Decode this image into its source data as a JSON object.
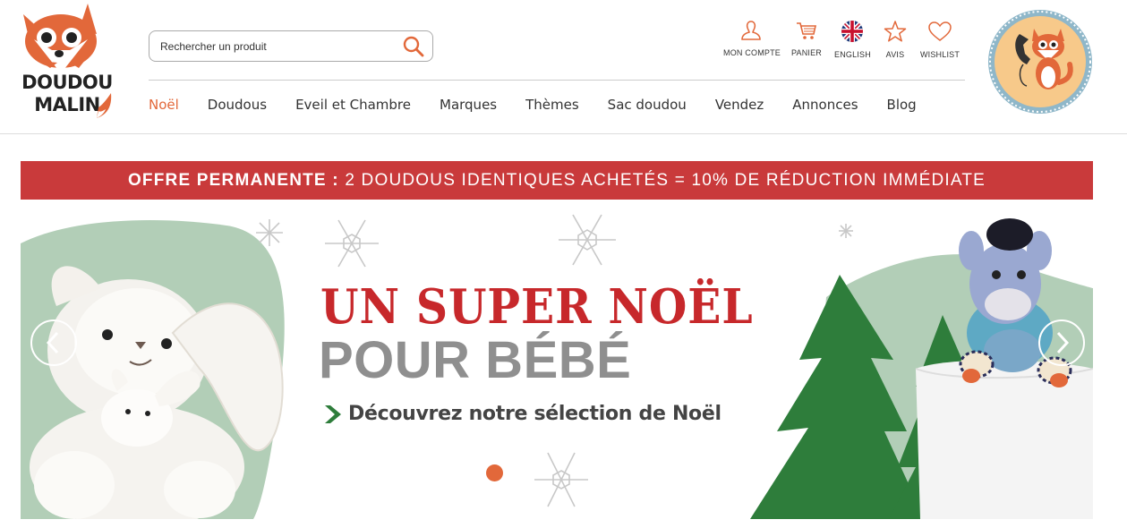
{
  "brand": {
    "logo_text_line1": "DOUDOU",
    "logo_text_line2": "MALIN",
    "accent": "#e2683a"
  },
  "search": {
    "placeholder": "Rechercher un produit",
    "icon": "search-icon"
  },
  "top_icons": [
    {
      "label": "MON COMPTE",
      "icon": "user-icon"
    },
    {
      "label": "PANIER",
      "icon": "cart-icon"
    },
    {
      "label": "ENGLISH",
      "icon": "uk-flag-icon"
    },
    {
      "label": "AVIS",
      "icon": "star-icon"
    },
    {
      "label": "WISHLIST",
      "icon": "heart-icon"
    }
  ],
  "nav": [
    {
      "label": "Noël",
      "active": true
    },
    {
      "label": "Doudous"
    },
    {
      "label": "Eveil et Chambre"
    },
    {
      "label": "Marques"
    },
    {
      "label": "Thèmes"
    },
    {
      "label": "Sac doudou"
    },
    {
      "label": "Vendez"
    },
    {
      "label": "Annonces"
    },
    {
      "label": "Blog"
    }
  ],
  "promo": {
    "bold": "OFFRE PERMANENTE :",
    "text": "2 DOUDOUS IDENTIQUES ACHETÉS = 10% DE RÉDUCTION IMMÉDIATE",
    "color": "#c93a3b"
  },
  "banner": {
    "headline1": "UN SUPER NOËL",
    "headline2": "POUR BÉBÉ",
    "cta": "Découvrez notre sélection de Noël",
    "slide_count": 1,
    "active_slide": 1
  }
}
